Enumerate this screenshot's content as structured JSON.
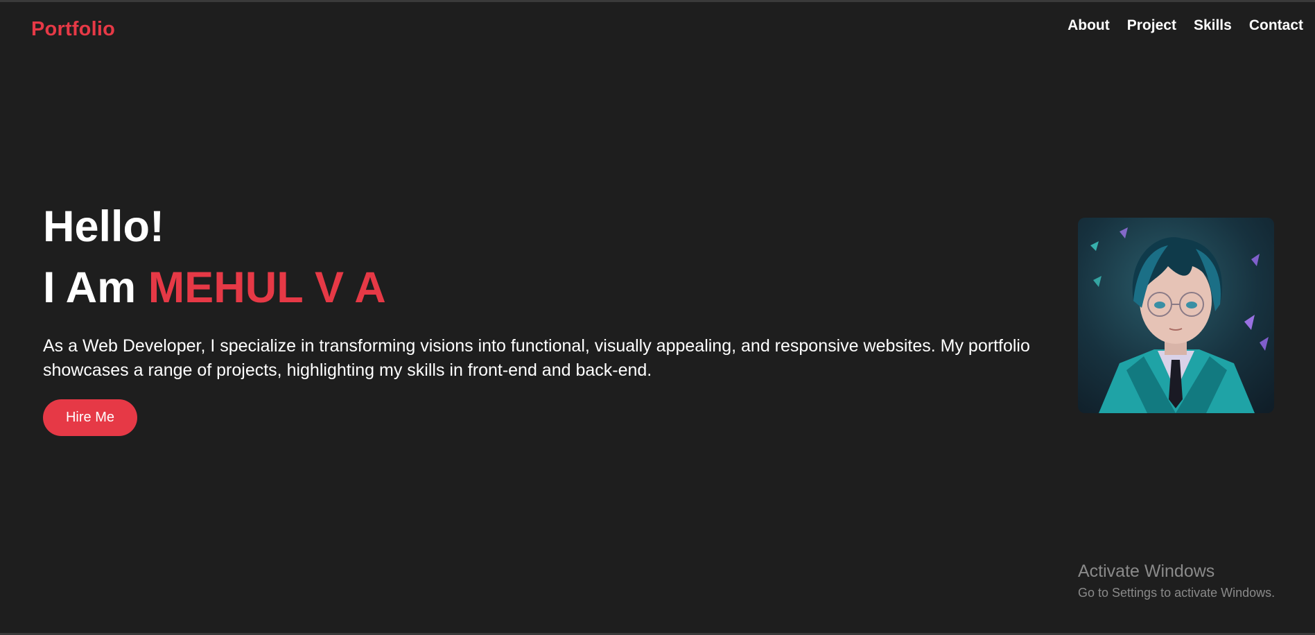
{
  "header": {
    "logo": "Portfolio",
    "nav": [
      "About",
      "Project",
      "Skills",
      "Contact"
    ]
  },
  "hero": {
    "greeting": "Hello!",
    "intro_prefix": "I Am",
    "name": "MEHUL V A",
    "description": "As a Web Developer, I specialize in transforming visions into functional, visually appealing, and responsive websites. My portfolio showcases a range of projects, highlighting my skills in front-end and back-end.",
    "cta_label": "Hire Me"
  },
  "watermark": {
    "title": "Activate Windows",
    "subtitle": "Go to Settings to activate Windows."
  },
  "colors": {
    "background": "#1e1e1e",
    "accent": "#e63946",
    "text": "#ffffff"
  }
}
